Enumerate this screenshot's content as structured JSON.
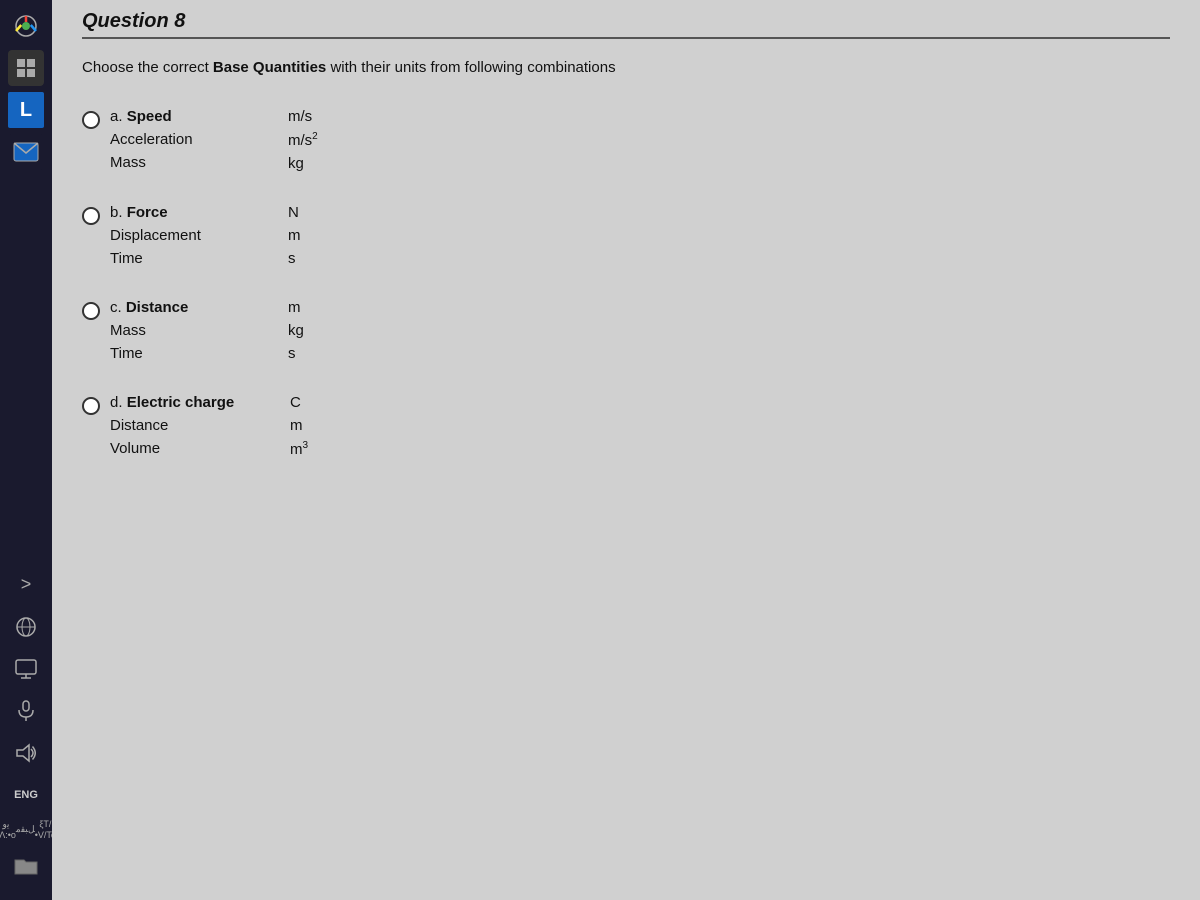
{
  "taskbar": {
    "icons": [
      {
        "name": "chrome",
        "label": "Chrome"
      },
      {
        "name": "grid",
        "label": "Grid"
      },
      {
        "name": "blue-l",
        "label": "L"
      },
      {
        "name": "mail",
        "label": "Mail"
      }
    ],
    "bottom": {
      "arrow_label": ">",
      "eng_label": "ENG",
      "arabic_line1": "ﻳﻭ •Λ:•ο",
      "arabic_line2": "ﻞﺒﻘﻣ",
      "arabic_line3": "ξT/•V/To"
    }
  },
  "question": {
    "title": "Question 8",
    "instruction_plain": "Choose the correct ",
    "instruction_bold": "Base Quantities",
    "instruction_rest": " with their units from following combinations",
    "options": [
      {
        "letter": "a",
        "items": [
          {
            "name": "Speed",
            "unit": "m/s",
            "bold": true
          },
          {
            "name": "Acceleration",
            "unit": "m/s²",
            "bold": false
          },
          {
            "name": "Mass",
            "unit": "kg",
            "bold": false
          }
        ]
      },
      {
        "letter": "b",
        "items": [
          {
            "name": "Force",
            "unit": "N",
            "bold": true
          },
          {
            "name": "Displacement",
            "unit": "m",
            "bold": false
          },
          {
            "name": "Time",
            "unit": "s",
            "bold": false
          }
        ]
      },
      {
        "letter": "c",
        "items": [
          {
            "name": "Distance",
            "unit": "m",
            "bold": true
          },
          {
            "name": "Mass",
            "unit": "kg",
            "bold": false
          },
          {
            "name": "Time",
            "unit": "s",
            "bold": false
          }
        ]
      },
      {
        "letter": "d",
        "items": [
          {
            "name": "Electric charge",
            "unit": "C",
            "bold": true
          },
          {
            "name": "Distance",
            "unit": "m",
            "bold": false
          },
          {
            "name": "Volume",
            "unit": "m³",
            "bold": false
          }
        ]
      }
    ]
  }
}
